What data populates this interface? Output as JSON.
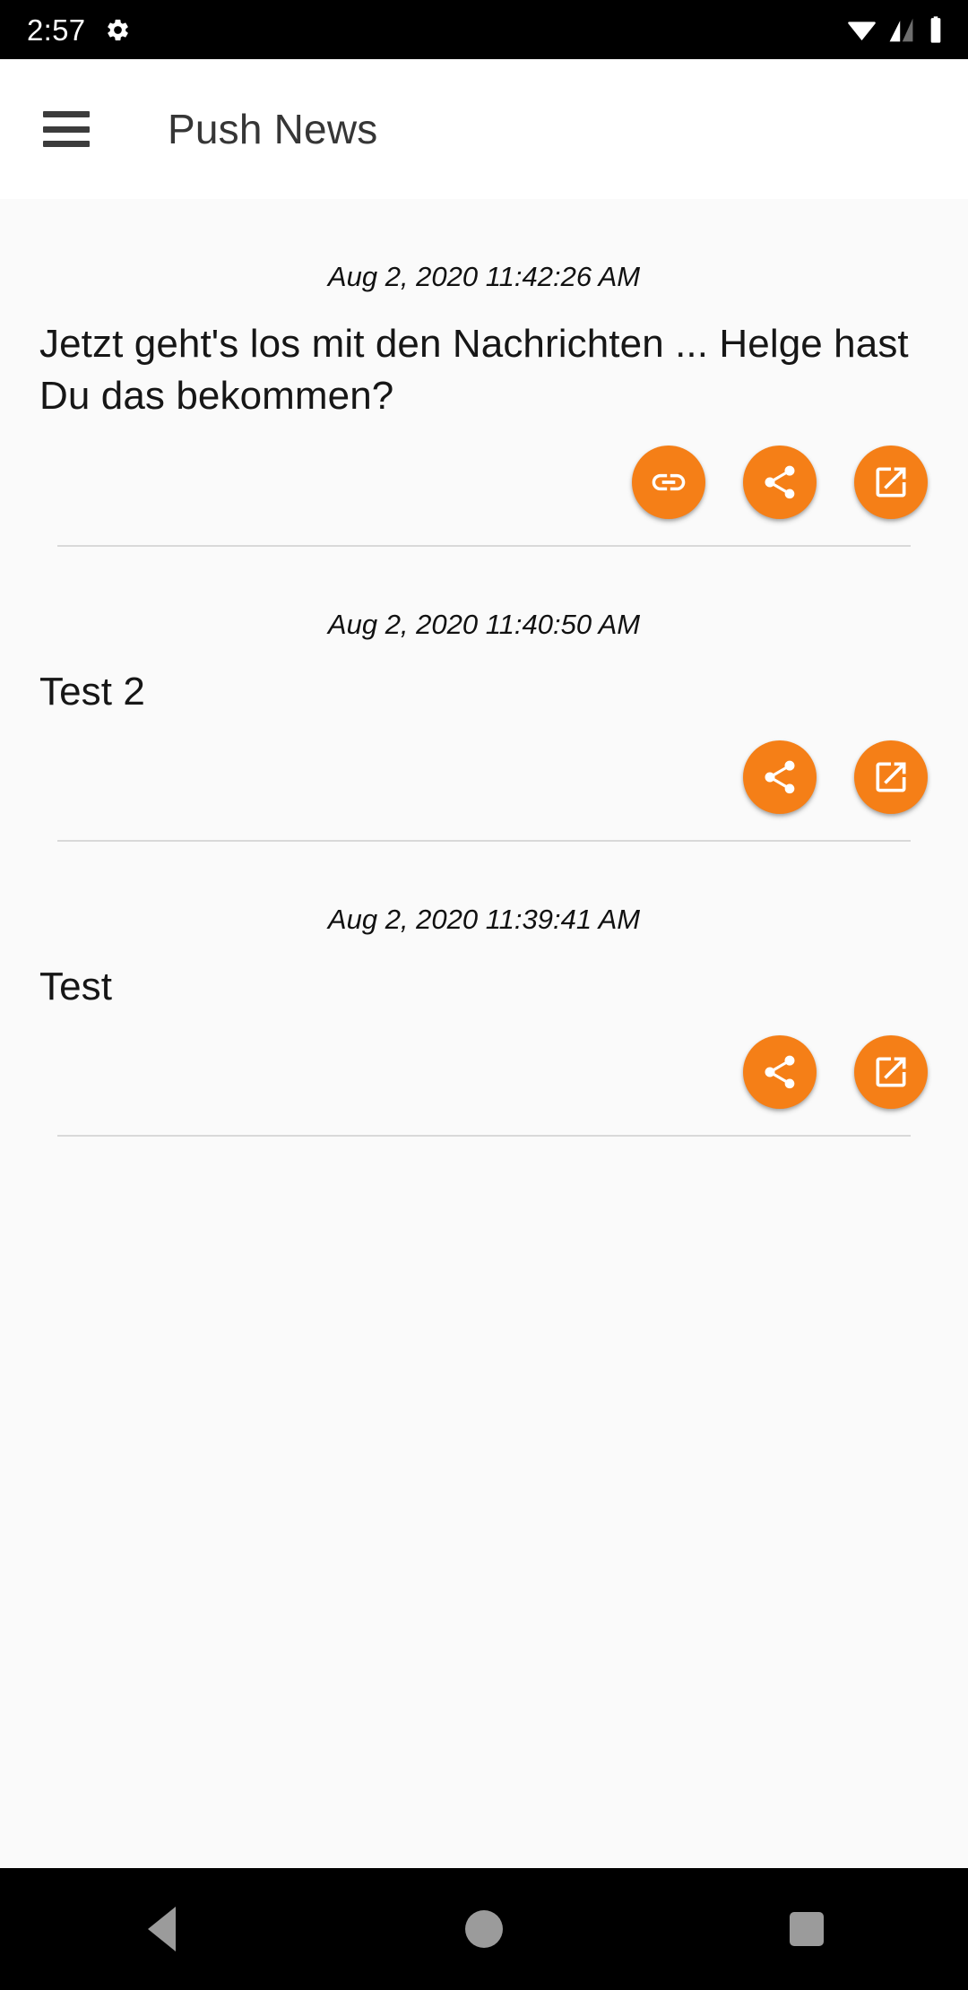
{
  "status_bar": {
    "clock": "2:57",
    "icons_left": [
      "gear-icon"
    ],
    "icons_right": [
      "wifi-icon",
      "signal-icon",
      "battery-icon"
    ],
    "background": "#000000"
  },
  "app_bar": {
    "menu_icon": "hamburger-menu-icon",
    "title": "Push News",
    "background": "#FFFFFF",
    "title_color": "#363636"
  },
  "theme": {
    "accent": "#F57F17",
    "page_background": "#FAFAFA",
    "divider": "#D9D9D9"
  },
  "news_items": [
    {
      "timestamp": "Aug 2, 2020 11:42:26 AM",
      "body": "Jetzt geht's los mit den Nachrichten ... Helge hast Du das bekommen?",
      "actions": [
        {
          "name": "link-icon",
          "label": "Link"
        },
        {
          "name": "share-icon",
          "label": "Share"
        },
        {
          "name": "open-in-new-icon",
          "label": "Open"
        }
      ]
    },
    {
      "timestamp": "Aug 2, 2020 11:40:50 AM",
      "body": "Test 2",
      "actions": [
        {
          "name": "share-icon",
          "label": "Share"
        },
        {
          "name": "open-in-new-icon",
          "label": "Open"
        }
      ]
    },
    {
      "timestamp": "Aug 2, 2020 11:39:41 AM",
      "body": "Test",
      "actions": [
        {
          "name": "share-icon",
          "label": "Share"
        },
        {
          "name": "open-in-new-icon",
          "label": "Open"
        }
      ]
    }
  ],
  "nav_bar": {
    "buttons": [
      {
        "name": "back-button",
        "icon": "triangle-left-icon"
      },
      {
        "name": "home-button",
        "icon": "circle-icon"
      },
      {
        "name": "recents-button",
        "icon": "square-icon"
      }
    ],
    "background": "#000000",
    "icon_color": "#9B9B9B"
  }
}
